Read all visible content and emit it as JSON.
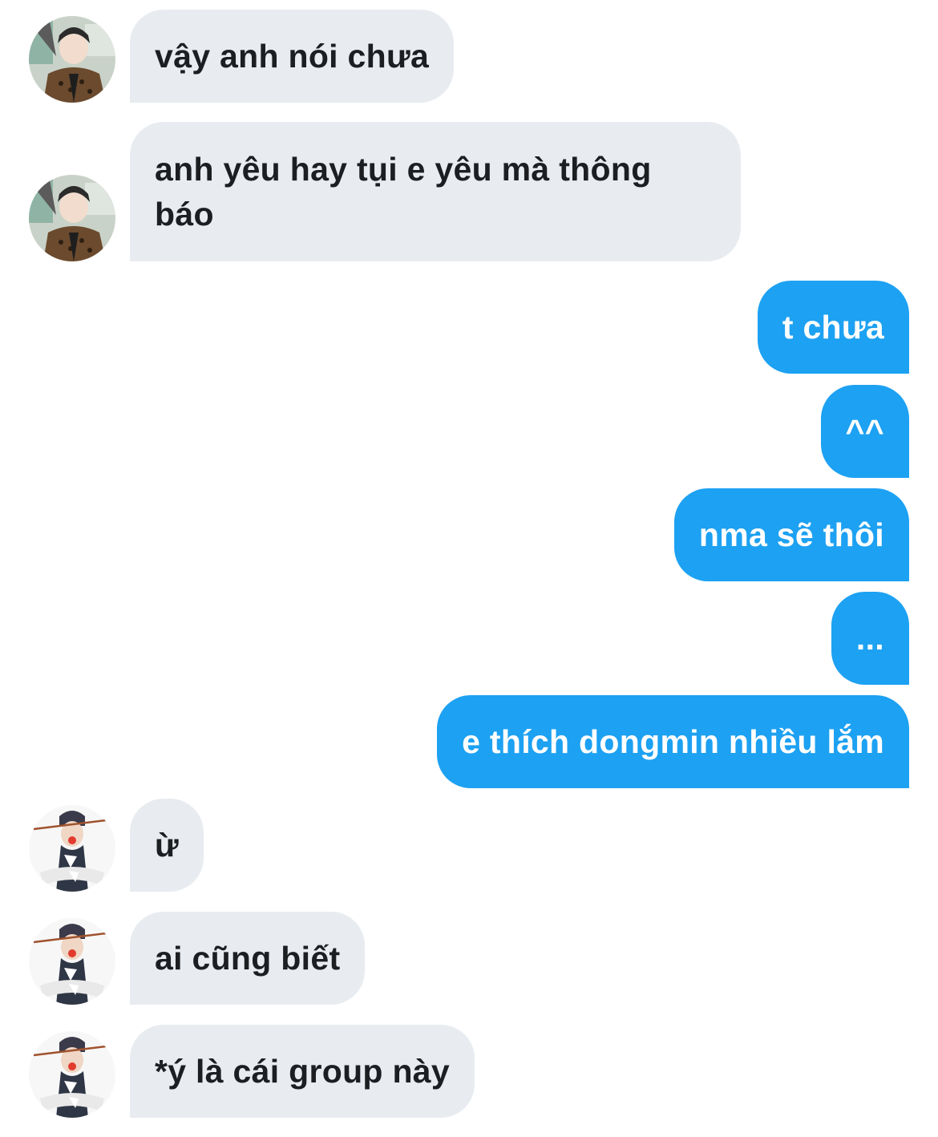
{
  "conversation": {
    "messages": [
      {
        "sender": "contact_a",
        "direction": "incoming",
        "text": "vậy anh nói chưa"
      },
      {
        "sender": "contact_a",
        "direction": "incoming",
        "text": "anh yêu hay tụi e yêu mà thông báo"
      },
      {
        "sender": "me",
        "direction": "outgoing",
        "text": "t chưa"
      },
      {
        "sender": "me",
        "direction": "outgoing",
        "text": "^^"
      },
      {
        "sender": "me",
        "direction": "outgoing",
        "text": "nma sẽ thôi"
      },
      {
        "sender": "me",
        "direction": "outgoing",
        "text": "..."
      },
      {
        "sender": "me",
        "direction": "outgoing",
        "text": "e thích dongmin nhiều lắm"
      },
      {
        "sender": "contact_b",
        "direction": "incoming",
        "text": "ừ"
      },
      {
        "sender": "contact_b",
        "direction": "incoming",
        "text": "ai cũng biết"
      },
      {
        "sender": "contact_b",
        "direction": "incoming",
        "text": "*ý là cái group này"
      }
    ]
  },
  "colors": {
    "incoming_bubble": "#e8ecf0",
    "incoming_text": "#1c1e21",
    "outgoing_bubble": "#1da1f2",
    "outgoing_text": "#ffffff",
    "background": "#ffffff"
  },
  "icons": {
    "contact_a_avatar": "avatar-photo-icon",
    "contact_b_avatar": "avatar-photo-icon"
  }
}
